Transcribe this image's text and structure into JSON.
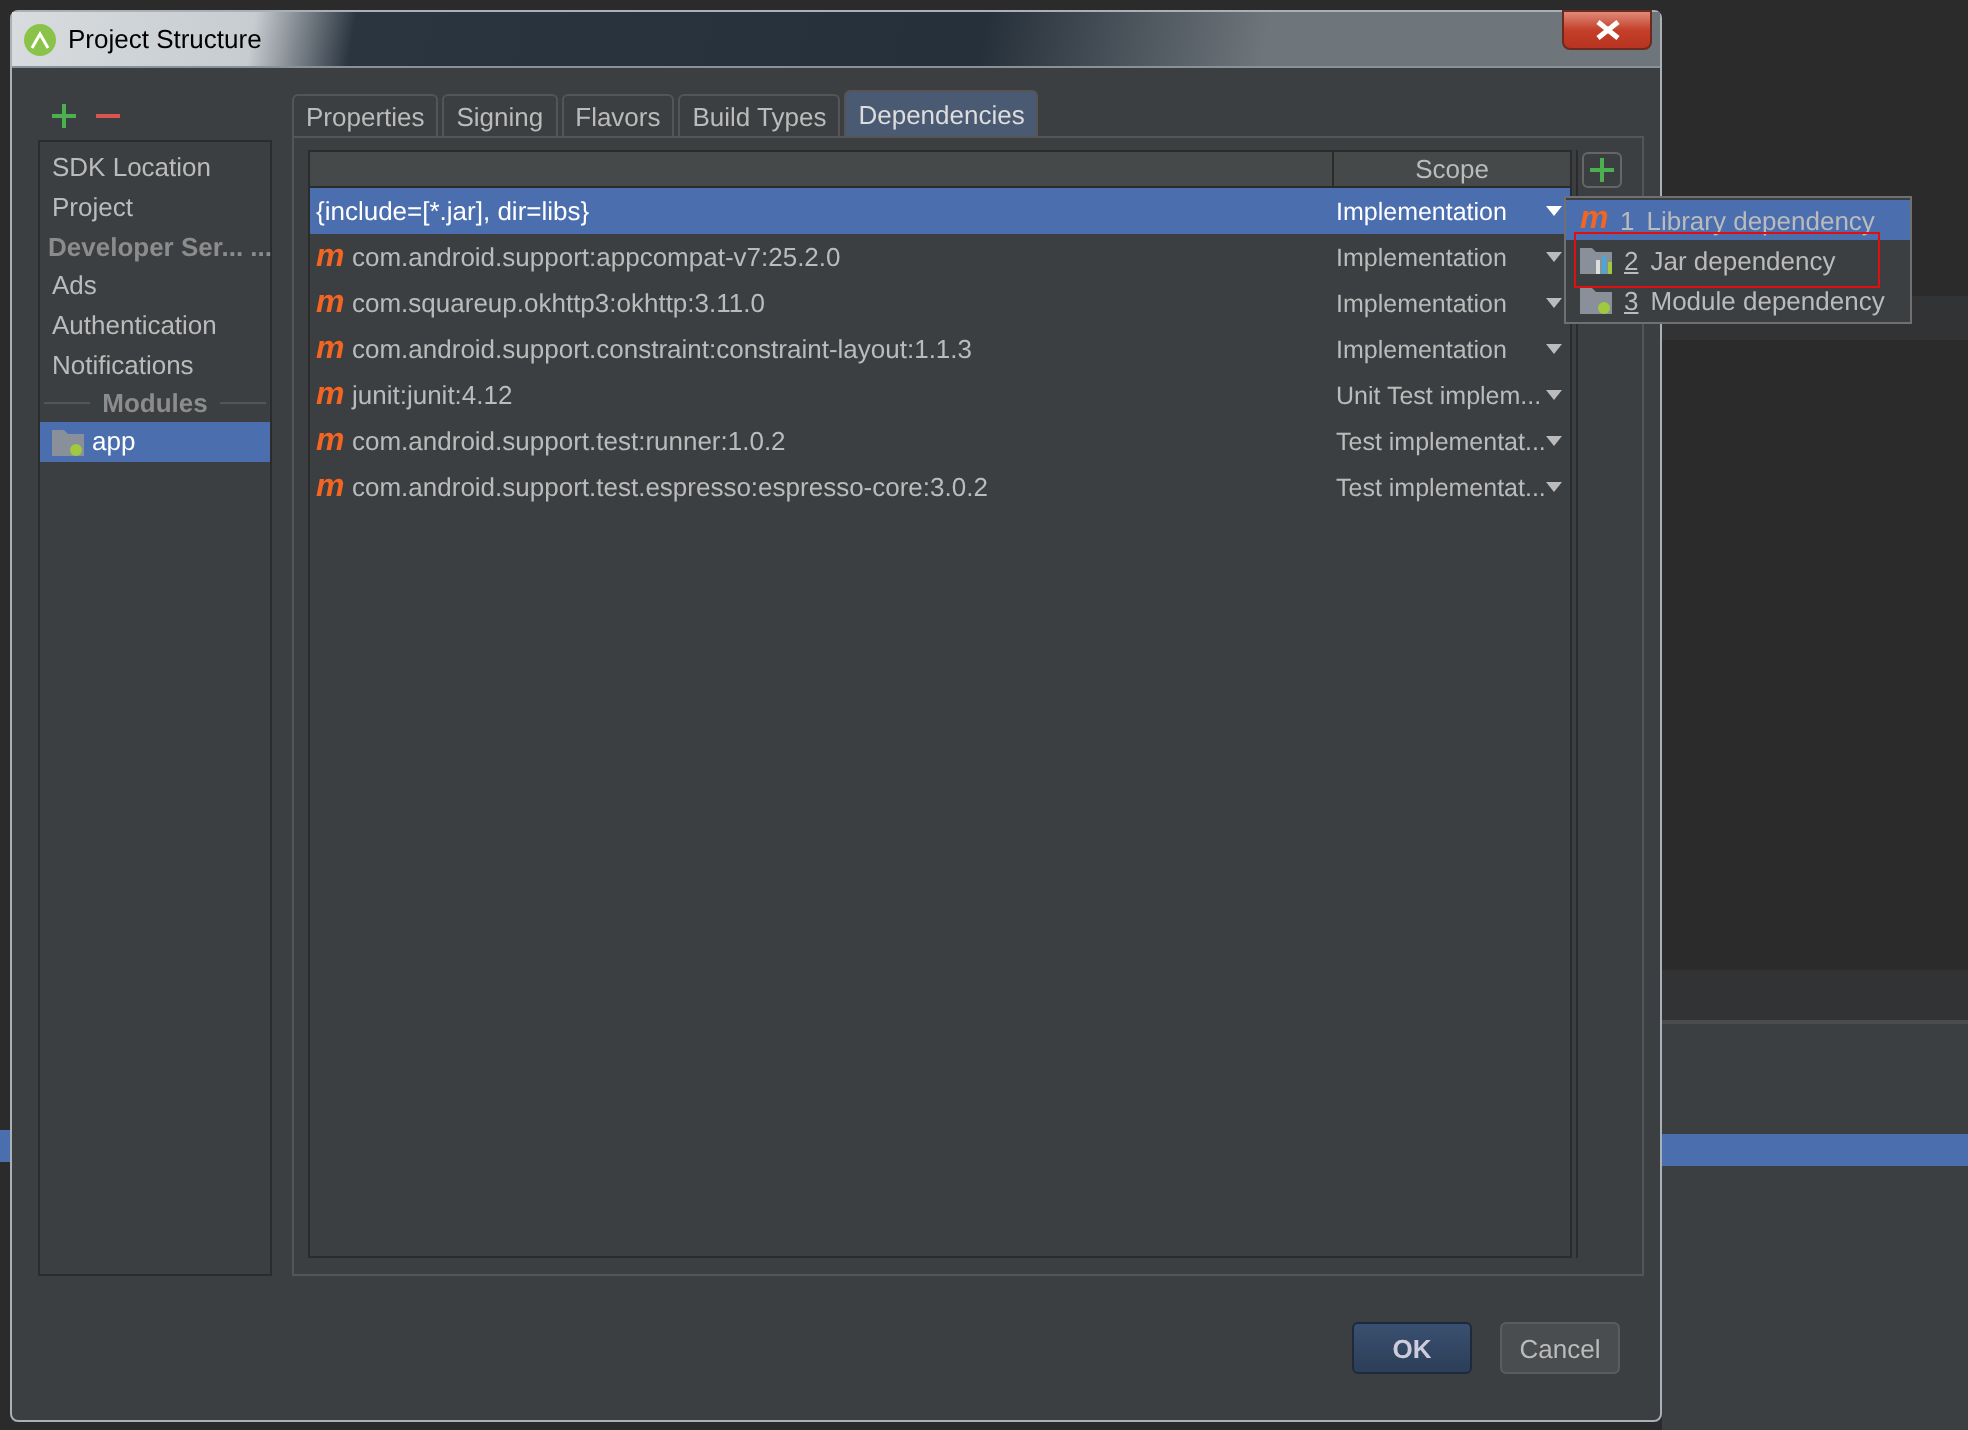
{
  "window": {
    "title": "Project Structure"
  },
  "sidebar": {
    "items": [
      {
        "kind": "item",
        "label": "SDK Location",
        "selected": false
      },
      {
        "kind": "item",
        "label": "Project",
        "selected": false
      },
      {
        "kind": "header",
        "label": "Developer Ser... ..."
      },
      {
        "kind": "item",
        "label": "Ads",
        "selected": false
      },
      {
        "kind": "item",
        "label": "Authentication",
        "selected": false
      },
      {
        "kind": "item",
        "label": "Notifications",
        "selected": false
      },
      {
        "kind": "separator",
        "label": "Modules"
      },
      {
        "kind": "module",
        "label": "app",
        "selected": true
      }
    ]
  },
  "tabs": [
    {
      "label": "Properties",
      "selected": false
    },
    {
      "label": "Signing",
      "selected": false
    },
    {
      "label": "Flavors",
      "selected": false
    },
    {
      "label": "Build Types",
      "selected": false
    },
    {
      "label": "Dependencies",
      "selected": true
    }
  ],
  "table": {
    "columns": [
      "Scope"
    ],
    "rows": [
      {
        "kind": "file",
        "name": "{include=[*.jar], dir=libs}",
        "scope": "Implementation",
        "selected": true
      },
      {
        "kind": "maven",
        "icon": "m",
        "name": "com.android.support:appcompat-v7:25.2.0",
        "scope": "Implementation",
        "selected": false
      },
      {
        "kind": "maven",
        "icon": "m",
        "name": "com.squareup.okhttp3:okhttp:3.11.0",
        "scope": "Implementation",
        "selected": false
      },
      {
        "kind": "maven",
        "icon": "m",
        "name": "com.android.support.constraint:constraint-layout:1.1.3",
        "scope": "Implementation",
        "selected": false
      },
      {
        "kind": "maven",
        "icon": "m",
        "name": "junit:junit:4.12",
        "scope": "Unit Test implem...",
        "selected": false
      },
      {
        "kind": "maven",
        "icon": "m",
        "name": "com.android.support.test:runner:1.0.2",
        "scope": "Test implementat...",
        "selected": false
      },
      {
        "kind": "maven",
        "icon": "m",
        "name": "com.android.support.test.espresso:espresso-core:3.0.2",
        "scope": "Test implementat...",
        "selected": false
      }
    ]
  },
  "add_menu": {
    "items": [
      {
        "kind": "library",
        "icon": "m",
        "number": "1",
        "label": "Library dependency",
        "selected": true,
        "highlighted": false
      },
      {
        "kind": "jar",
        "number": "2",
        "label": "Jar dependency",
        "selected": false,
        "highlighted": true
      },
      {
        "kind": "module",
        "number": "3",
        "label": "Module dependency",
        "selected": false,
        "highlighted": false
      }
    ]
  },
  "buttons": [
    {
      "kind": "default",
      "label": "OK"
    },
    {
      "kind": "normal",
      "label": "Cancel"
    }
  ]
}
